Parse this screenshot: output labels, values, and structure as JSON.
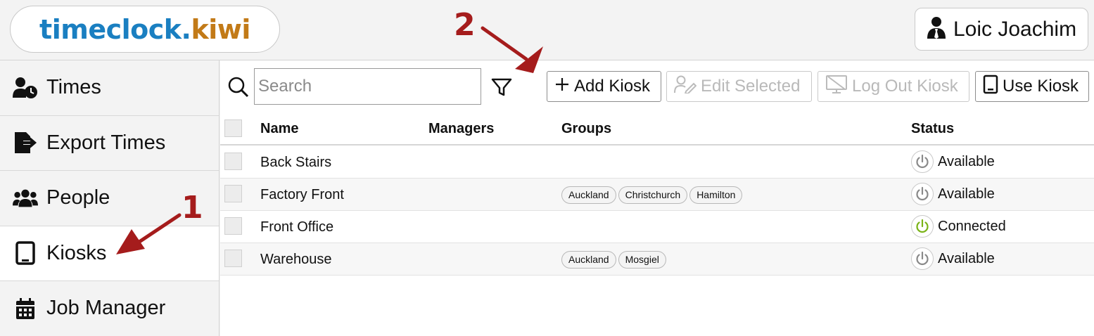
{
  "header": {
    "logo_part1": "timeclock.",
    "logo_part2": "kiwi",
    "user_name": "Loic Joachim"
  },
  "sidebar": {
    "items": [
      {
        "label": "Times",
        "icon": "user-clock-icon"
      },
      {
        "label": "Export Times",
        "icon": "file-export-icon"
      },
      {
        "label": "People",
        "icon": "users-icon"
      },
      {
        "label": "Kiosks",
        "icon": "tablet-icon",
        "active": true
      },
      {
        "label": "Job Manager",
        "icon": "calendar-icon"
      }
    ]
  },
  "toolbar": {
    "search_placeholder": "Search",
    "add_label": "Add Kiosk",
    "edit_label": "Edit Selected",
    "logout_label": "Log Out Kiosk",
    "use_label": "Use Kiosk"
  },
  "table": {
    "columns": [
      "Name",
      "Managers",
      "Groups",
      "Status"
    ],
    "rows": [
      {
        "name": "Back Stairs",
        "groups": [],
        "status": "Available"
      },
      {
        "name": "Factory Front",
        "groups": [
          "Auckland",
          "Christchurch",
          "Hamilton"
        ],
        "status": "Available"
      },
      {
        "name": "Front Office",
        "groups": [],
        "status": "Connected"
      },
      {
        "name": "Warehouse",
        "groups": [
          "Auckland",
          "Mosgiel"
        ],
        "status": "Available"
      }
    ]
  },
  "annotations": {
    "step1": "1",
    "step2": "2"
  },
  "colors": {
    "logo_blue": "#1a7fc1",
    "logo_orange": "#c27a17",
    "annotation_red": "#a51c1c",
    "connected_green": "#7ab317",
    "available_gray": "#8a8a8a"
  }
}
